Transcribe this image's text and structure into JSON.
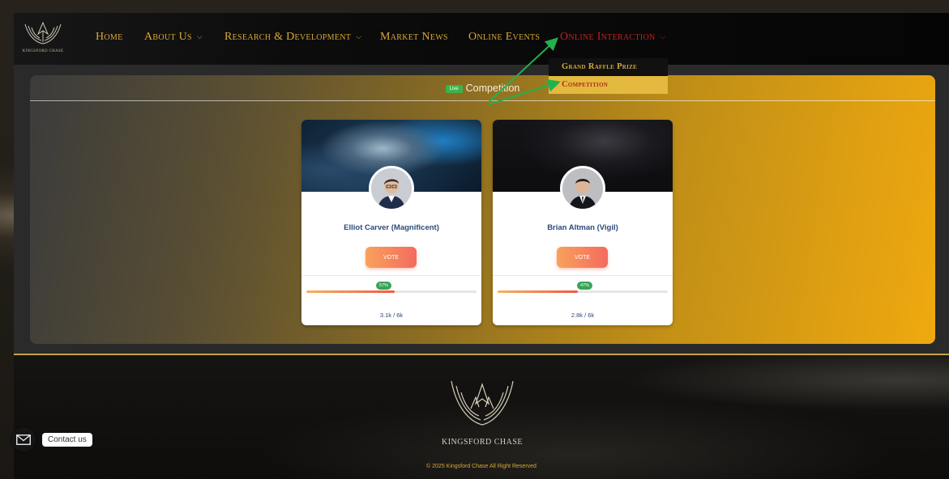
{
  "brand": {
    "logo_text": "Kingsford Chase",
    "footer_name": "KINGSFORD CHASE"
  },
  "nav": {
    "items": [
      {
        "label": "Home",
        "has_dropdown": false
      },
      {
        "label": "About Us",
        "has_dropdown": true
      },
      {
        "label": "Research & Development",
        "has_dropdown": true
      },
      {
        "label": "Market News",
        "has_dropdown": false
      },
      {
        "label": "Online Events",
        "has_dropdown": false
      },
      {
        "label": "Online Interaction",
        "has_dropdown": true,
        "active": true
      }
    ],
    "dropdown": {
      "items": [
        {
          "label": "Grand Raffle Prize",
          "selected": false
        },
        {
          "label": "Competition",
          "selected": true
        }
      ]
    }
  },
  "panel": {
    "badge": "Live",
    "title": "Competition"
  },
  "cards": [
    {
      "name": "Elliot Carver (Magnificent)",
      "vote_label": "VOTE",
      "percent_label": "57%",
      "percent": 0.52,
      "count": "3.1k / 6k"
    },
    {
      "name": "Brian Altman (Vigil)",
      "vote_label": "VOTE",
      "percent_label": "47%",
      "percent": 0.47,
      "count": "2.8k / 6k"
    }
  ],
  "footer": {
    "copyright": "© 2025 Kingsford Chase All Right Reserved"
  },
  "contact": {
    "label": "Contact us"
  },
  "colors": {
    "accent_gold": "#d9a834",
    "active_red": "#c41f1f",
    "live_green": "#3bb34a",
    "annotation_arrow": "#22b14c"
  }
}
